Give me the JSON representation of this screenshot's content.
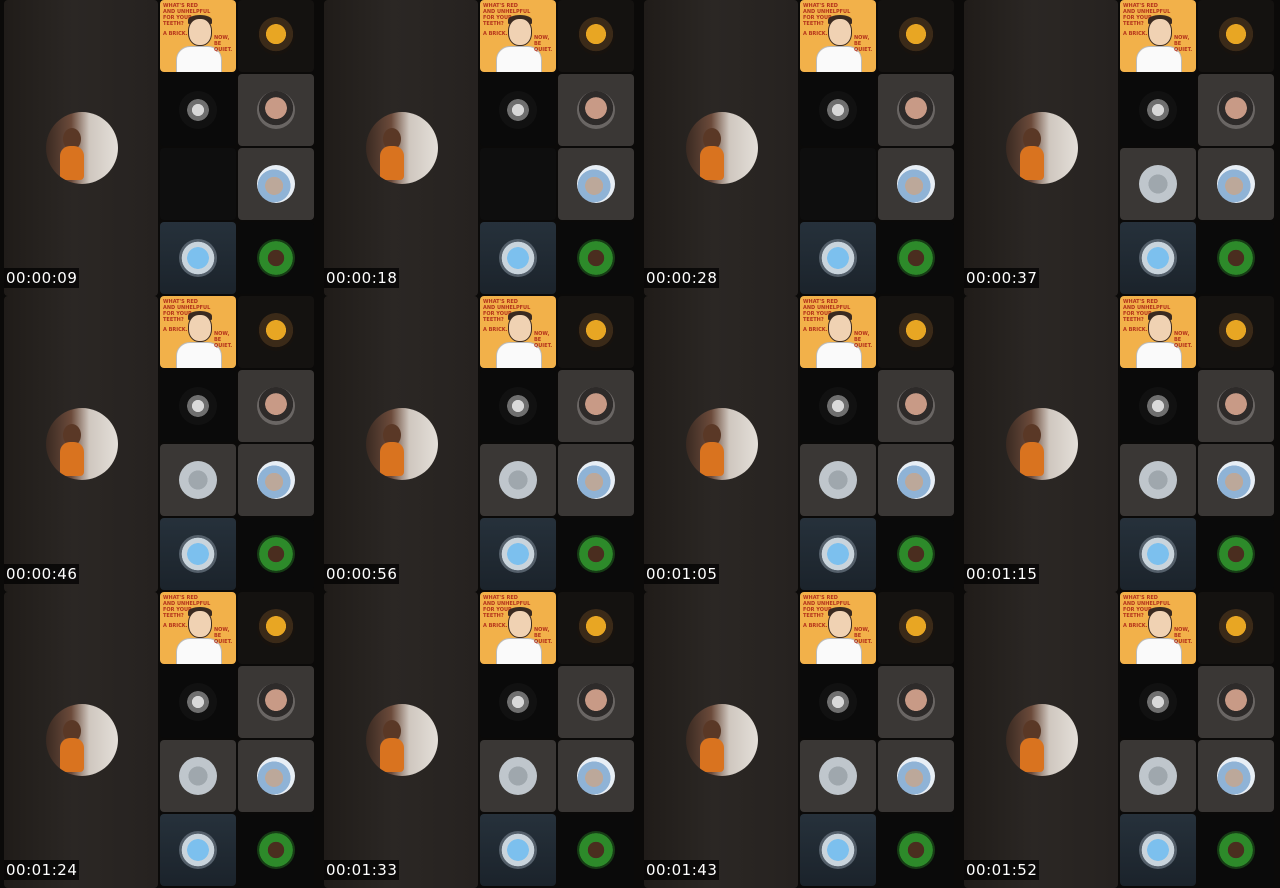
{
  "contact_sheet": {
    "frames": [
      {
        "timestamp": "00:00:09"
      },
      {
        "timestamp": "00:00:18"
      },
      {
        "timestamp": "00:00:28"
      },
      {
        "timestamp": "00:00:37"
      },
      {
        "timestamp": "00:00:46"
      },
      {
        "timestamp": "00:00:56"
      },
      {
        "timestamp": "00:01:05"
      },
      {
        "timestamp": "00:01:15"
      },
      {
        "timestamp": "00:01:24"
      },
      {
        "timestamp": "00:01:33"
      },
      {
        "timestamp": "00:01:43"
      },
      {
        "timestamp": "00:01:52"
      }
    ],
    "meme_tile": {
      "top_text": "WHAT'S RED AND UNHELPFUL FOR YOUR TEETH?",
      "left_text": "A BRICK.",
      "right_text": "NOW, BE QUIET."
    },
    "participant_icons": [
      "beer-avatar-icon",
      "crown-avatar-icon",
      "man-avatar-icon",
      "cooler-avatar-icon",
      "woman-avatar-icon"
    ]
  }
}
